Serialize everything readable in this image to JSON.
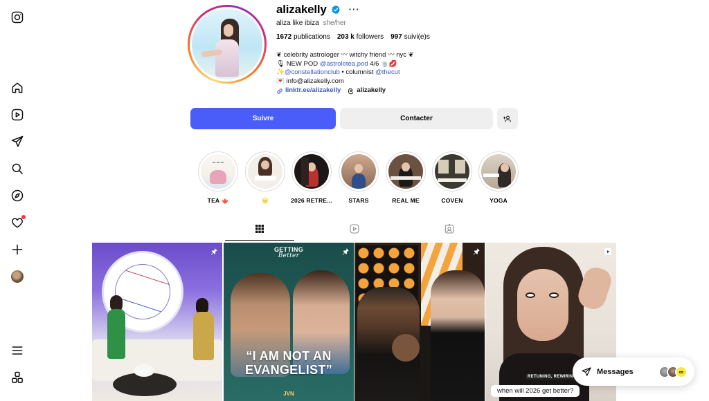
{
  "rail": {
    "items": [
      {
        "name": "instagram-icon"
      },
      {
        "name": "home-icon"
      },
      {
        "name": "reels-icon"
      },
      {
        "name": "direct-icon"
      },
      {
        "name": "search-icon"
      },
      {
        "name": "explore-icon"
      },
      {
        "name": "heart-icon",
        "has_badge": true
      },
      {
        "name": "create-icon"
      },
      {
        "name": "profile-avatar"
      },
      {
        "name": "menu-icon"
      },
      {
        "name": "apps-icon"
      }
    ]
  },
  "profile": {
    "username": "alizakelly",
    "verified": true,
    "more": "···",
    "display_name": "aliza like ibiza",
    "pronouns": "she/her",
    "stats": {
      "posts_value": "1672",
      "posts_label": "publications",
      "followers_value": "203 k",
      "followers_label": "followers",
      "following_value": "997",
      "following_label": "suivi(e)s"
    },
    "bio": {
      "line1": "❦ celebrity astrologer 〰 witchy friend 〰 nyc ❦",
      "line2_prefix": "🎙 NEW POD ",
      "line2_tag": "@astrolotea.pod",
      "line2_suffix": " 4/6 🍵💋",
      "line3_prefix": "✨",
      "line3_tag1": "@constellationclub",
      "line3_mid": " • columnist ",
      "line3_tag2": "@thecut",
      "line4": "💌 info@alizakelly.com",
      "link": "linktr.ee/alizakelly",
      "threads": "alizakelly"
    },
    "accent_color": "#4a5df9"
  },
  "actions": {
    "follow": "Suivre",
    "contact": "Contacter"
  },
  "highlights": [
    {
      "label": "TEA 🫖"
    },
    {
      "label": "🌝"
    },
    {
      "label": "2026 RETRE..."
    },
    {
      "label": "STARS"
    },
    {
      "label": "REAL ME"
    },
    {
      "label": "COVEN"
    },
    {
      "label": "YOGA"
    }
  ],
  "tabs": [
    {
      "name": "posts-grid-icon",
      "active": true
    },
    {
      "name": "reels-tab-icon",
      "active": false
    },
    {
      "name": "tagged-tab-icon",
      "active": false
    }
  ],
  "posts": {
    "p2_title_top": "GETTING",
    "p2_title_script": "Better",
    "p2_quote": "“I AM NOT AN EVANGELIST”",
    "p2_tag": "JVN",
    "p4_caption_small": "RETUNING, REWIRING OU",
    "p4_caption": "when will 2026 get better?"
  },
  "messages": {
    "label": "Messages",
    "extra_avatar_glyph": "∞"
  }
}
